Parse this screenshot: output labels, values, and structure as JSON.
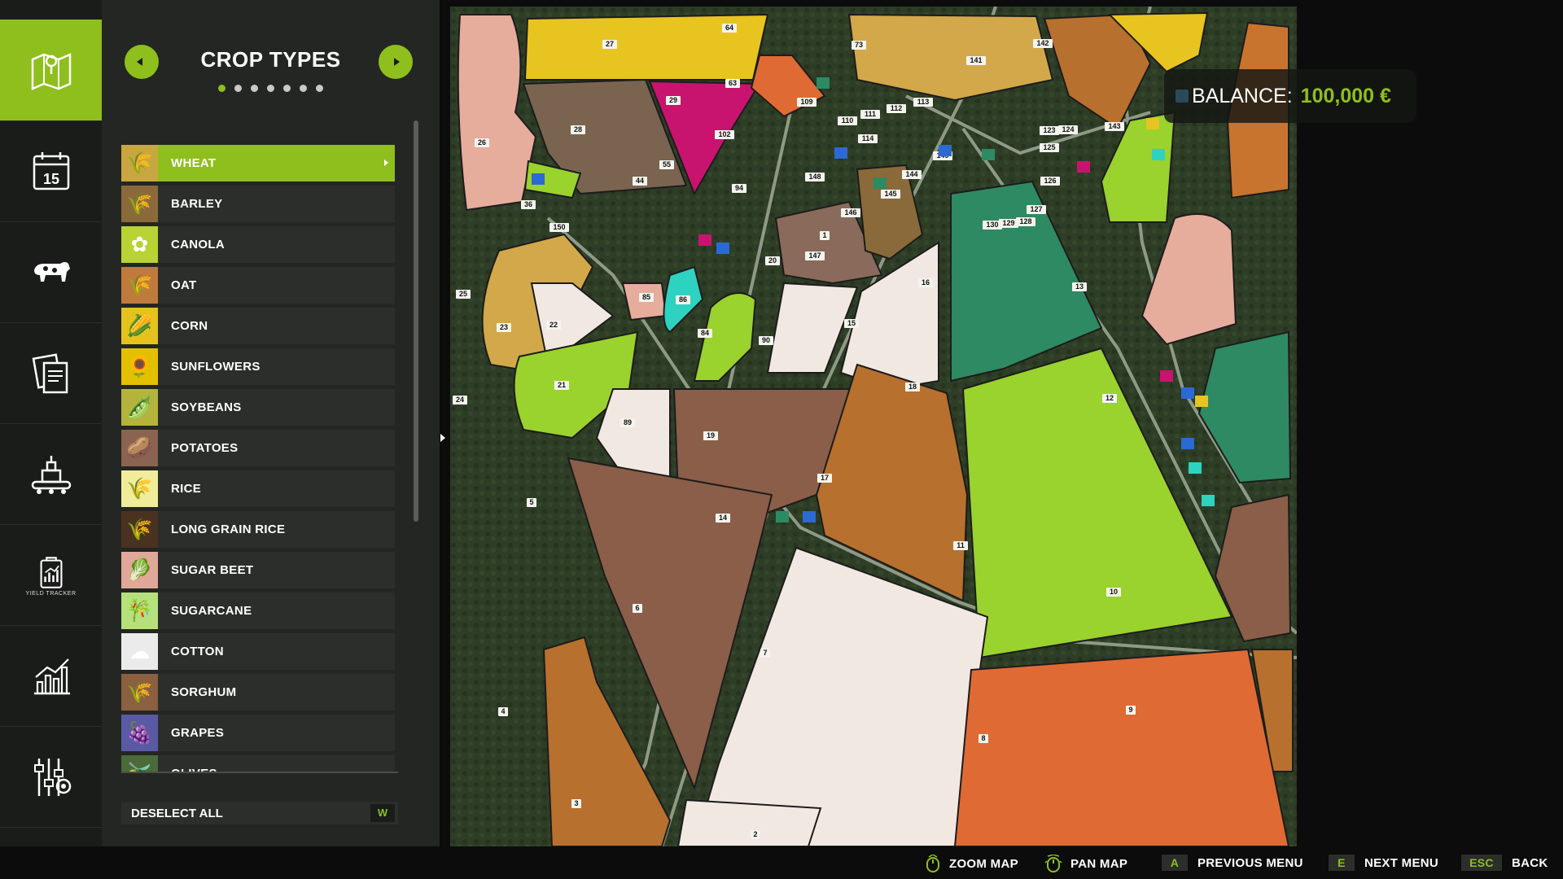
{
  "rail": {
    "items": [
      {
        "name": "map",
        "active": true
      },
      {
        "name": "calendar",
        "badge": "15"
      },
      {
        "name": "animals"
      },
      {
        "name": "contracts"
      },
      {
        "name": "production"
      },
      {
        "name": "yield-tracker",
        "sub": "YIELD TRACKER"
      },
      {
        "name": "statistics"
      },
      {
        "name": "settings"
      }
    ]
  },
  "panel": {
    "title": "CROP TYPES",
    "page_count": 7,
    "current_page": 1,
    "crops": [
      {
        "label": "WHEAT",
        "icon": "🌾",
        "bg": "#c8a640",
        "selected": true
      },
      {
        "label": "BARLEY",
        "icon": "🌾",
        "bg": "#8a6a3a"
      },
      {
        "label": "CANOLA",
        "icon": "✿",
        "bg": "#b9d234"
      },
      {
        "label": "OAT",
        "icon": "🌾",
        "bg": "#c07a3c"
      },
      {
        "label": "CORN",
        "icon": "🌽",
        "bg": "#e6c21e"
      },
      {
        "label": "SUNFLOWERS",
        "icon": "🌻",
        "bg": "#e2c000"
      },
      {
        "label": "SOYBEANS",
        "icon": "🫛",
        "bg": "#b4b43c"
      },
      {
        "label": "POTATOES",
        "icon": "🥔",
        "bg": "#8a6450"
      },
      {
        "label": "RICE",
        "icon": "🌾",
        "bg": "#f0ec9a"
      },
      {
        "label": "LONG GRAIN RICE",
        "icon": "🌾",
        "bg": "#4a3220"
      },
      {
        "label": "SUGAR BEET",
        "icon": "🥬",
        "bg": "#e0a898"
      },
      {
        "label": "SUGARCANE",
        "icon": "🎋",
        "bg": "#b6e07c"
      },
      {
        "label": "COTTON",
        "icon": "☁",
        "bg": "#ebebeb"
      },
      {
        "label": "SORGHUM",
        "icon": "🌾",
        "bg": "#8a6040"
      },
      {
        "label": "GRAPES",
        "icon": "🍇",
        "bg": "#5a5aa4"
      },
      {
        "label": "OLIVES",
        "icon": "🫒",
        "bg": "#4a6a3a"
      }
    ],
    "deselect": {
      "label": "DESELECT ALL",
      "key": "W"
    }
  },
  "balance": {
    "label": "BALANCE:",
    "value": "100,000 €"
  },
  "hints": [
    {
      "key": "",
      "icon": "mouse",
      "label": "ZOOM MAP"
    },
    {
      "key": "",
      "icon": "mouse",
      "label": "PAN MAP"
    },
    {
      "key": "A",
      "label": "PREVIOUS MENU"
    },
    {
      "key": "E",
      "label": "NEXT MENU"
    },
    {
      "key": "ESC",
      "label": "BACK"
    }
  ],
  "colors": {
    "accent": "#8fbf1c",
    "panel": "#232623",
    "rail": "#1a1c1a"
  },
  "map": {
    "fields": [
      {
        "id": "1",
        "color": "#f2e8e2"
      },
      {
        "id": "2",
        "color": "#f2e8e2"
      },
      {
        "id": "3",
        "color": "#b8702e"
      },
      {
        "id": "4",
        "color": ""
      },
      {
        "id": "5",
        "color": ""
      },
      {
        "id": "6",
        "color": "#8a5e48"
      },
      {
        "id": "7",
        "color": "#f2e8e2"
      },
      {
        "id": "8",
        "color": "#e06a34"
      },
      {
        "id": "9",
        "color": "#b8702e"
      },
      {
        "id": "10",
        "color": "#8a5e48"
      },
      {
        "id": "11",
        "color": "#9ad22e"
      },
      {
        "id": "12",
        "color": "#2e8a62"
      },
      {
        "id": "13",
        "color": "#e6ac9c"
      },
      {
        "id": "14",
        "color": ""
      },
      {
        "id": "15",
        "color": "#f2e8e2"
      },
      {
        "id": "16",
        "color": "#2e8a62"
      },
      {
        "id": "17",
        "color": "#b8702e"
      },
      {
        "id": "18",
        "color": ""
      },
      {
        "id": "19",
        "color": "#8a5e48"
      },
      {
        "id": "20",
        "color": "#8a6a5a"
      },
      {
        "id": "21",
        "color": "#9ad22e"
      },
      {
        "id": "22",
        "color": "#f2e8e2"
      },
      {
        "id": "23",
        "color": "#d2a84a"
      },
      {
        "id": "24",
        "color": ""
      },
      {
        "id": "25",
        "color": ""
      },
      {
        "id": "26",
        "color": "#e6ac9c"
      },
      {
        "id": "27",
        "color": "#e8c420"
      },
      {
        "id": "28",
        "color": "#7a6450"
      },
      {
        "id": "29",
        "color": "#c8146e"
      },
      {
        "id": "73",
        "color": "#d2a84a"
      },
      {
        "id": "84",
        "color": "#9ad22e"
      },
      {
        "id": "86",
        "color": "#2ed2c0"
      },
      {
        "id": "89",
        "color": "#f2e8e2"
      },
      {
        "id": "90",
        "color": "#f2e8e2"
      },
      {
        "id": "141",
        "color": "#b8702e"
      },
      {
        "id": "142",
        "color": "#e8c420"
      },
      {
        "id": "143",
        "color": "#c8742e"
      },
      {
        "id": "146",
        "color": "#8a6a3a"
      },
      {
        "id": "63",
        "color": "#e06a34"
      },
      {
        "id": "64",
        "color": ""
      },
      {
        "id": "85",
        "color": "#e6ac9c"
      },
      {
        "id": "36",
        "color": ""
      },
      {
        "id": "150",
        "color": ""
      },
      {
        "id": "102",
        "color": "#2e8a62"
      },
      {
        "id": "94",
        "color": "#e6ac9c"
      },
      {
        "id": "55",
        "color": "#c8146e"
      },
      {
        "id": "44",
        "color": "#7a6450"
      },
      {
        "id": "109",
        "color": ""
      },
      {
        "id": "110",
        "color": ""
      },
      {
        "id": "111",
        "color": ""
      },
      {
        "id": "112",
        "color": ""
      },
      {
        "id": "113",
        "color": ""
      },
      {
        "id": "114",
        "color": ""
      },
      {
        "id": "123",
        "color": ""
      },
      {
        "id": "124",
        "color": ""
      },
      {
        "id": "125",
        "color": ""
      },
      {
        "id": "126",
        "color": ""
      },
      {
        "id": "127",
        "color": ""
      },
      {
        "id": "128",
        "color": ""
      },
      {
        "id": "129",
        "color": ""
      },
      {
        "id": "130",
        "color": ""
      },
      {
        "id": "144",
        "color": ""
      },
      {
        "id": "145",
        "color": ""
      },
      {
        "id": "147",
        "color": ""
      },
      {
        "id": "148",
        "color": ""
      },
      {
        "id": "149",
        "color": ""
      }
    ]
  }
}
